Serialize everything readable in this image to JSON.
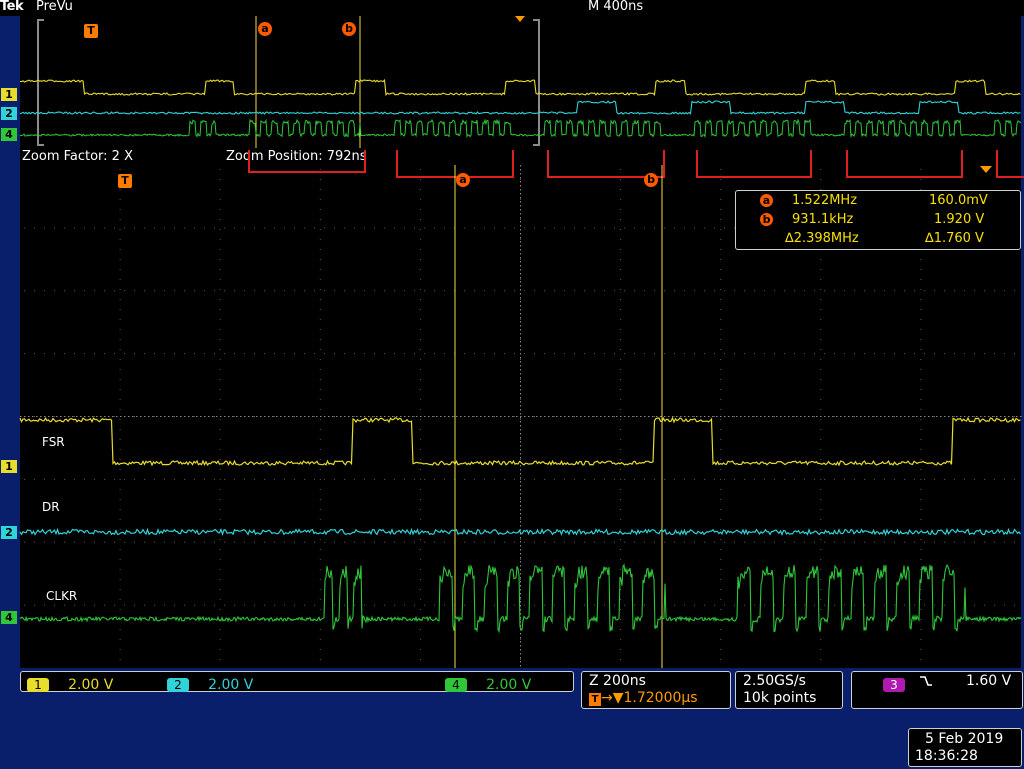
{
  "header": {
    "brand": "Tek",
    "mode": "PreVu",
    "timebase": "M 400ns"
  },
  "zoom": {
    "factor_text": "Zoom Factor: 2 X",
    "position_text": "Zoom Position: 792ns"
  },
  "markers": {
    "trigger": "T",
    "cursor_a": "a",
    "cursor_b": "b"
  },
  "channel_markers": {
    "ch1": "1",
    "ch2": "2",
    "ch4": "4"
  },
  "signals": {
    "ch1_name": "FSR",
    "ch2_name": "DR",
    "ch4_name": "CLKR"
  },
  "measurements": {
    "a": {
      "label": "a",
      "freq": "1.522MHz",
      "volt": "160.0mV"
    },
    "b": {
      "label": "b",
      "freq": "931.1kHz",
      "volt": "1.920 V"
    },
    "delta": {
      "freq": "∆2.398MHz",
      "volt": "∆1.760 V"
    }
  },
  "status": {
    "ch1": {
      "num": "1",
      "scale": "2.00 V"
    },
    "ch2": {
      "num": "2",
      "scale": "2.00 V"
    },
    "ch4": {
      "num": "4",
      "scale": "2.00 V"
    },
    "zoom_scale": "Z 200ns",
    "trigger_position": "▼1.72000µs",
    "sample_rate": "2.50GS/s",
    "record_length": "10k points",
    "trigger_channel": "3",
    "trigger_slope": "⮠",
    "trigger_level": "1.60 V"
  },
  "datetime": {
    "date": "5 Feb  2019",
    "time": "18:36:28"
  },
  "colors": {
    "ch1": "#e8dc2c",
    "ch2": "#2fd3d8",
    "ch4": "#2fc63a",
    "ch3": "#b01ab0",
    "marker": "#ff5a00",
    "zoom_bracket": "#e02020",
    "background": "#0a1f6b"
  }
}
